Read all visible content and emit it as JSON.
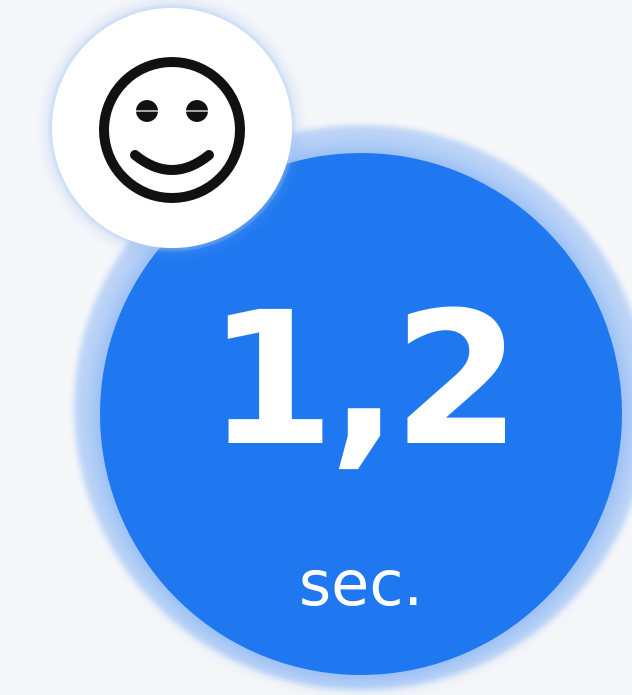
{
  "metric": {
    "value": "1,2",
    "unit": "sec."
  },
  "icons": {
    "face": "smiley-face-icon"
  },
  "colors": {
    "badge": "#1f78f0",
    "badge_halo": "#bcd4f7",
    "text": "#ffffff",
    "icon": "#111111"
  }
}
